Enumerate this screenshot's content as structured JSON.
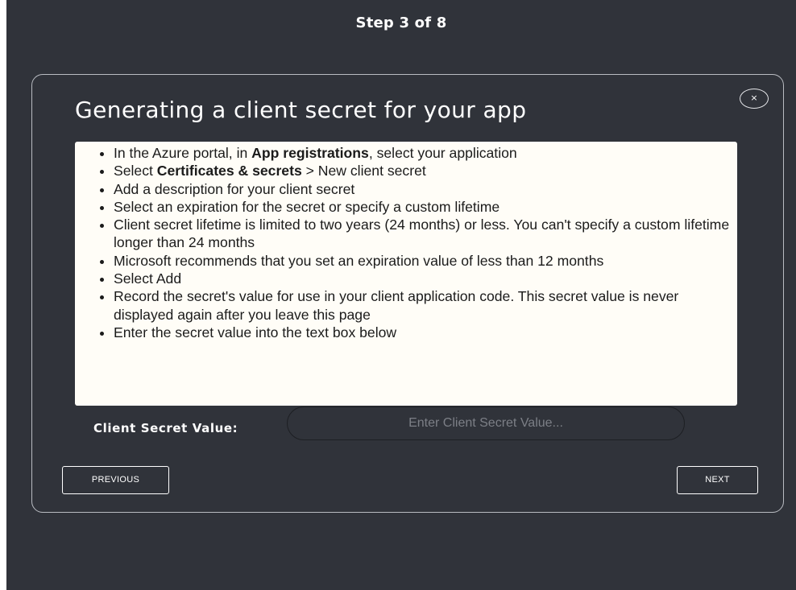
{
  "header": {
    "step_label": "Step 3 of  8"
  },
  "dialog": {
    "title": "Generating a client secret for your app",
    "close_label": "×",
    "instructions": [
      {
        "pre": "In the Azure portal, in ",
        "bold": "App registrations",
        "post": ", select your application"
      },
      {
        "pre": "Select ",
        "bold": "Certificates & secrets",
        "post": " > New client secret"
      },
      {
        "pre": "Add a description for your client secret",
        "bold": "",
        "post": ""
      },
      {
        "pre": "Select an expiration for the secret or specify a custom lifetime",
        "bold": "",
        "post": ""
      },
      {
        "pre": "Client secret lifetime is limited to two years (24 months) or less. You can't specify a custom lifetime longer than 24 months",
        "bold": "",
        "post": ""
      },
      {
        "pre": "Microsoft recommends that you set an expiration value of less than 12 months",
        "bold": "",
        "post": ""
      },
      {
        "pre": "Select Add",
        "bold": "",
        "post": ""
      },
      {
        "pre": "Record the secret's value for use in your client application code. This secret value is never displayed again after you leave this page",
        "bold": "",
        "post": ""
      },
      {
        "pre": "Enter the secret value into the text box below",
        "bold": "",
        "post": ""
      }
    ],
    "secret_field": {
      "label": "Client Secret Value:",
      "value": "",
      "placeholder": "Enter Client Secret Value..."
    },
    "buttons": {
      "previous": "PREVIOUS",
      "next": "NEXT"
    }
  }
}
